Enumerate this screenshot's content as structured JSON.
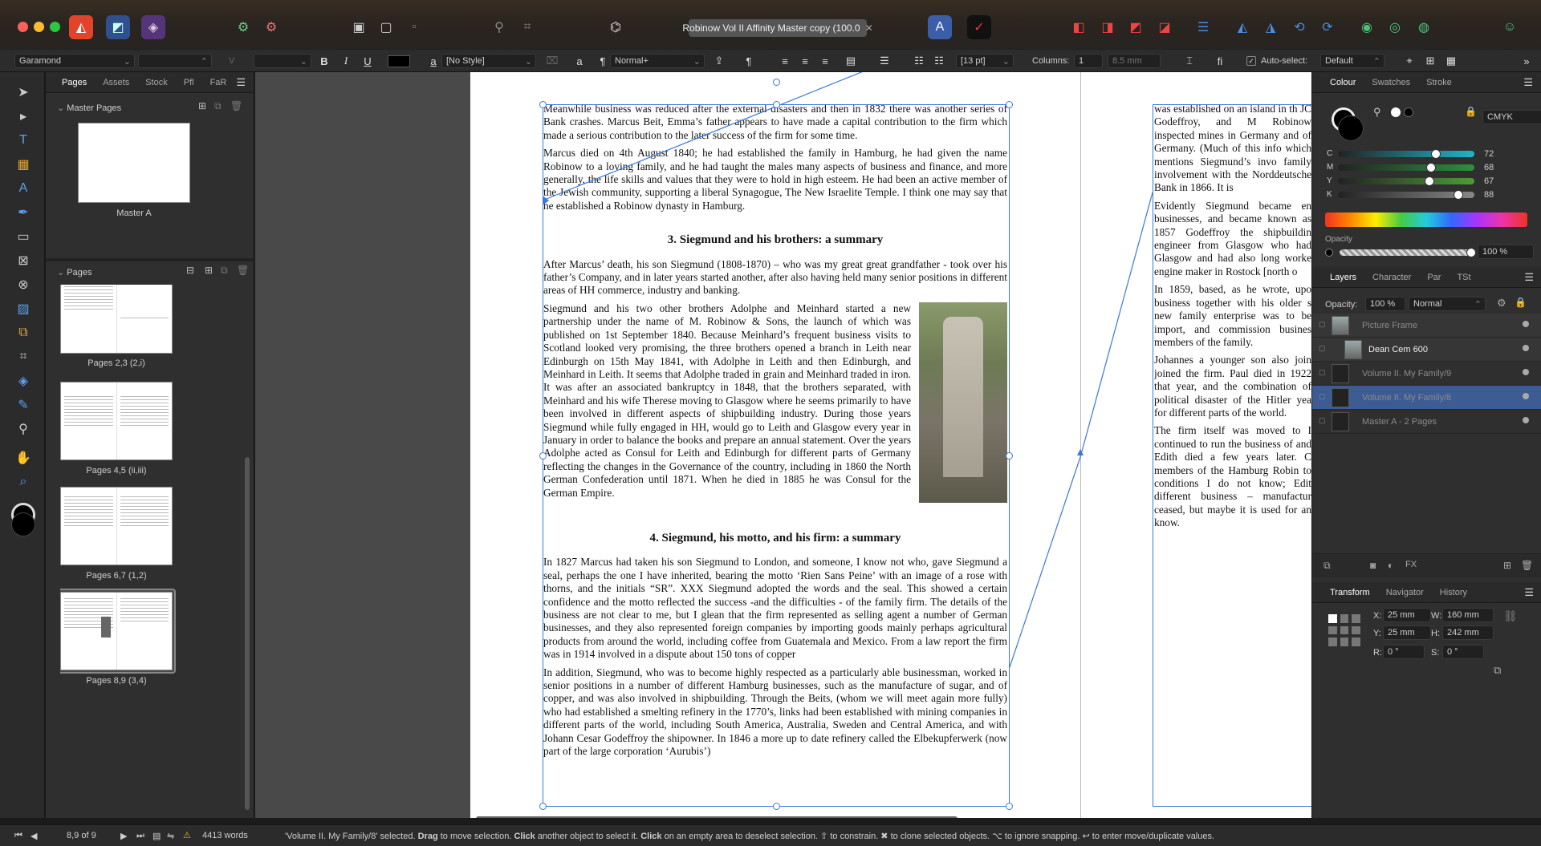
{
  "titlebar": {
    "document_title": "Robinow Vol II Affinity Master copy (100.0",
    "close_glyph": "✕"
  },
  "context_toolbar": {
    "font_family": "Garamond",
    "font_style": "",
    "font_size": "",
    "bold": "B",
    "italic": "I",
    "underline": "U",
    "char_style": "[No Style]",
    "para_style": "Normal+",
    "pilcrow": "¶",
    "leading": "[13 pt]",
    "columns_label": "Columns:",
    "columns_value": "1",
    "gutter": "8.5 mm",
    "autoselect_label": "Auto-select:",
    "autoselect_value": "Default",
    "glyph_a": "a",
    "glyph_fi": "fi"
  },
  "left_panel": {
    "tabs": [
      "Pages",
      "Assets",
      "Stock",
      "Pfl",
      "FaR"
    ],
    "master_section": "Master Pages",
    "master_caption": "Master A",
    "pages_section": "Pages",
    "page_captions": [
      "Pages 2,3 (2,i)",
      "Pages 4,5 (ii,iii)",
      "Pages 6,7 (1,2)",
      "Pages 8,9 (3,4)"
    ]
  },
  "document": {
    "left_column": [
      "Meanwhile business was reduced after the external disasters and then in 1832 there was another series of Bank crashes. Marcus Beit, Emma’s father appears to have made a capital contribution to the firm which made a serious contribution to the later success of the firm for some time.",
      "Marcus died on 4th August 1840; he had established the family in Hamburg, he had given the name Robinow to a loving family, and he had taught the males many aspects of business and finance, and more generally, the life skills and values that they were to hold in high esteem. He had been an active member of the Jewish community, supporting a liberal Synagogue, The New Israelite Temple. I think one may say that he established a Robinow dynasty in Hamburg."
    ],
    "heading_3": "3. Siegmund and his brothers: a summary",
    "section_3": [
      "After Marcus’ death, his son Siegmund (1808-1870) – who was my great great grandfather - took over his father’s Company, and in later years started another, after also having held many senior positions in different areas of HH commerce, industry and banking.",
      "Siegmund and his two other brothers Adolphe and Meinhard started a new partnership under the name of M. Robinow & Sons, the launch of which was published on 1st September 1840. Because Meinhard’s frequent business visits to Scotland looked very promising, the three brothers opened a branch in Leith near Edinburgh on 15th May 1841, with Adolphe in Leith and then Edinburgh, and Meinhard in Leith. It seems that Adolphe traded in grain and Meinhard traded in iron. It was after an associated bankruptcy in 1848, that the brothers separated, with Meinhard and his wife Therese moving to Glasgow where he seems primarily to have been involved in different aspects of shipbuilding industry. During those years Siegmund while fully engaged in HH, would go to Leith and Glasgow every year in January in order to balance the books and prepare an annual statement. Over the years Adolphe acted as Consul for Leith and Edinburgh for different parts of Germany reflecting the changes in the Governance of the country, including in 1860 the North German Confederation until 1871. When he died in 1885 he was Consul for the German Empire."
    ],
    "heading_4": "4. Siegmund, his motto, and his firm: a summary",
    "section_4": [
      "In 1827 Marcus had taken his son Siegmund to London, and someone, I know not who, gave Siegmund a seal, perhaps the one I have inherited, bearing the motto ‘Rien Sans Peine’ with an image of a rose with thorns, and the initials “SR”. XXX Siegmund adopted the words and the seal. This showed a certain confidence and the motto reflected the success -and the difficulties - of the family firm. The details of the business are not clear to me, but I glean that the firm represented as selling agent a number of German businesses, and they also represented foreign companies by importing goods mainly perhaps agricultural products from around the world, including coffee from Guatemala and Mexico. From a law report the firm was in 1914 involved in a dispute about 150 tons of copper",
      "In addition, Siegmund, who was to become highly respected as a particularly able businessman, worked in senior positions in a number of different Hamburg businesses, such as the manufacture of sugar, and of copper, and was also involved in shipbuilding. Through the Beits, (whom we will meet again more fully) who had established a smelting refinery in the 1770’s, links had been established with mining companies in different parts of the world, including South America, Australia, Sweden and Central America, and with Johann Cesar Godeffroy the shipowner. In 1846 a more up to date refinery called the Elbekupferwerk (now part of the large corporation ‘Aurubis’)"
    ],
    "right_column": [
      "was established on an island in th JC Godeffroy, and M Robinow inspected mines in Germany and of Germany. (Much of this info which mentions Siegmund’s invo family involvement with the Norddeutsche Bank in 1866. It is",
      "Evidently Siegmund became en businesses, and became known as 1857 Godeffroy the shipbuildin engineer from Glasgow who had Glasgow and had also long worke engine maker in Rostock [north o",
      "In 1859, based, as he wrote, upo business together with his older s new family enterprise was to be import, and commission busines members of the family.",
      "Johannes a younger son also join joined the firm. Paul died in 1922 that year, and the combination of political disaster of the Hitler yea for different parts of the world.",
      "The firm itself was moved to I continued to run the business of and Edith died a few years later. C members of the Hamburg Robin to conditions I do not know; Edit different business – manufactur ceased, but maybe it is used for an know."
    ]
  },
  "colour_panel": {
    "tabs": [
      "Colour",
      "Swatches",
      "Stroke"
    ],
    "model": "CMYK",
    "channels": [
      {
        "label": "C",
        "value": "72",
        "fraction": 0.72,
        "color": "#1fb5c8"
      },
      {
        "label": "M",
        "value": "68",
        "fraction": 0.68,
        "color": "#2e8f3e"
      },
      {
        "label": "Y",
        "value": "67",
        "fraction": 0.67,
        "color": "#4f9b3a"
      },
      {
        "label": "K",
        "value": "88",
        "fraction": 0.88,
        "color": "#888888"
      }
    ],
    "opacity_label": "Opacity",
    "opacity_value": "100 %"
  },
  "layers_panel": {
    "tabs": [
      "Layers",
      "Character",
      "Par",
      "TSt"
    ],
    "opacity_label": "Opacity:",
    "opacity_value": "100 %",
    "blend_mode": "Normal",
    "layers": [
      {
        "name": "Picture Frame",
        "dim": true,
        "selected": false
      },
      {
        "name": "Dean Cem 600",
        "dim": false,
        "selected": false
      },
      {
        "name": "Volume II. My Family/9",
        "dim": true,
        "selected": false
      },
      {
        "name": "Volume II. My Family/8",
        "dim": true,
        "selected": true
      },
      {
        "name": "Master A - 2 Pages",
        "dim": true,
        "selected": false
      }
    ]
  },
  "transform_panel": {
    "tabs": [
      "Transform",
      "Navigator",
      "History"
    ],
    "x_label": "X:",
    "x_value": "25 mm",
    "y_label": "Y:",
    "y_value": "25 mm",
    "w_label": "W:",
    "w_value": "160 mm",
    "h_label": "H:",
    "h_value": "242 mm",
    "r_label": "R:",
    "r_value": "0 °",
    "s_label": "S:",
    "s_value": "0 °"
  },
  "statusbar": {
    "page_indicator": "8,9 of 9",
    "word_count": "4413 words",
    "message_selected": "'Volume II. My Family/8' selected.",
    "drag": "Drag",
    "drag_text": "to move selection.",
    "click": "Click",
    "click_text": "another object to select it.",
    "click2": "Click",
    "click2_text": "on an empty area to deselect selection.",
    "hint_tail": "⇧ to constrain. ✖ to clone selected objects. ⌥ to ignore snapping. ↩ to enter move/duplicate values."
  }
}
